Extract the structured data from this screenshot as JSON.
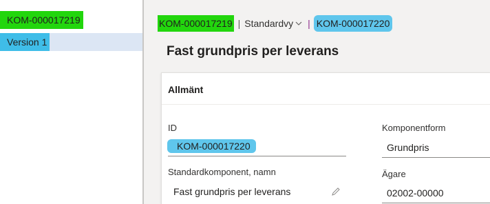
{
  "left_nav": {
    "items": [
      {
        "label": "KOM-000017219"
      },
      {
        "label": "Version 1"
      }
    ]
  },
  "breadcrumb": {
    "record_id": "KOM-000017219",
    "separator": "|",
    "view_label": "Standardvy",
    "current_id": "KOM-000017220"
  },
  "page": {
    "title": "Fast grundpris per leverans"
  },
  "section": {
    "title": "Allmänt",
    "fields": {
      "id": {
        "label": "ID",
        "value": "KOM-000017220"
      },
      "standard_component_name": {
        "label": "Standardkomponent, namn",
        "value": "Fast grundpris per leverans"
      },
      "component_form": {
        "label": "Komponentform",
        "value": "Grundpris"
      },
      "owner": {
        "label": "Ägare",
        "value": "02002-00000"
      }
    }
  },
  "colors": {
    "highlight_green": "#22d60d",
    "highlight_blue": "#3fbde8",
    "selected_row": "#dce6f4"
  },
  "icons": [
    "chevron-down-icon",
    "pencil-icon"
  ]
}
